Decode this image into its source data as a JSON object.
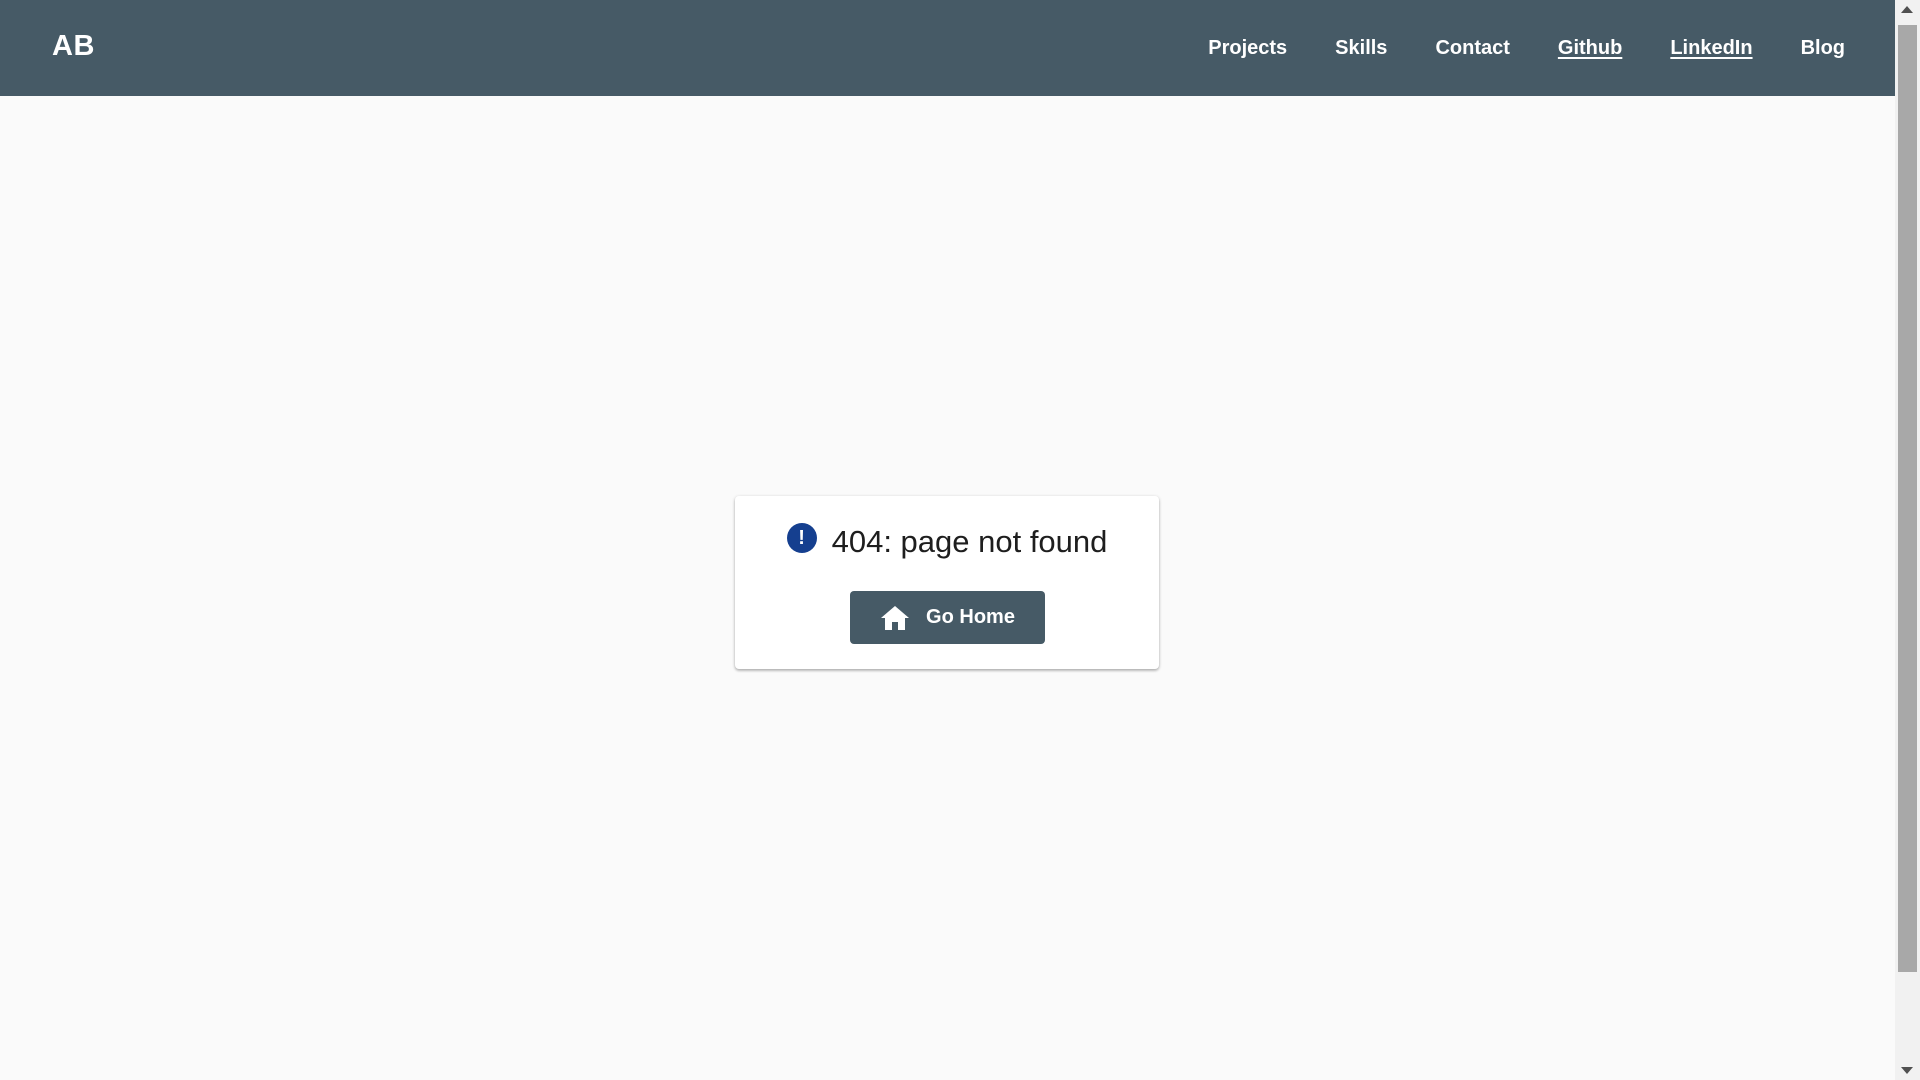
{
  "navbar": {
    "brand": "AB",
    "links": [
      {
        "label": "Projects"
      },
      {
        "label": "Skills"
      },
      {
        "label": "Contact"
      },
      {
        "label": "Github"
      },
      {
        "label": "LinkedIn"
      },
      {
        "label": "Blog"
      }
    ]
  },
  "error_card": {
    "icon": "exclamation-circle-icon",
    "icon_glyph": "!",
    "title": "404: page not found",
    "button": {
      "icon": "home-icon",
      "label": "Go Home"
    }
  },
  "colors": {
    "navbar_bg": "#465a66",
    "page_bg": "#fafafa",
    "alert_icon": "#153f8f",
    "button_bg": "#465a66"
  }
}
